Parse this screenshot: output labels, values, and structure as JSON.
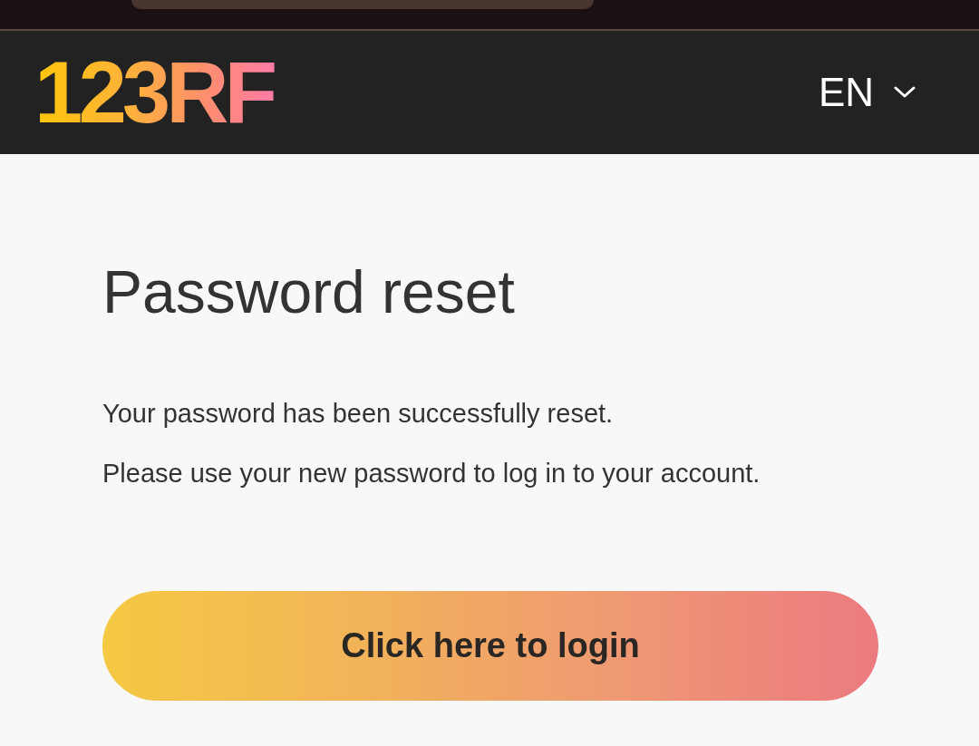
{
  "header": {
    "logo": "123RF",
    "language": "EN"
  },
  "title": "Password reset",
  "messages": [
    "Your password has been successfully reset.",
    "Please use your new password to log in to your account."
  ],
  "login_button": "Click here to login"
}
